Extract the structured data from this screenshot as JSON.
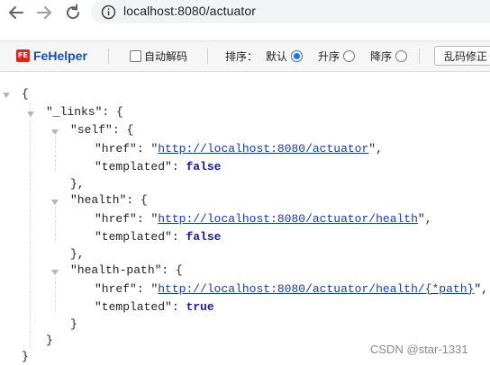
{
  "browser": {
    "url": "localhost:8080/actuator"
  },
  "fehelper": {
    "logo_mark": "FE",
    "logo_text": "FeHelper",
    "auto_decode_label": "自动解码",
    "sort_label": "排序：",
    "sort_options": [
      {
        "label": "默认",
        "selected": true
      },
      {
        "label": "升序",
        "selected": false
      },
      {
        "label": "降序",
        "selected": false
      }
    ],
    "fix_button_label": "乱码修正"
  },
  "json": {
    "open_root": "{",
    "links_key": "\"_links\"",
    "open_obj": "{",
    "colon": ":",
    "comma": ",",
    "close_obj_comma": "},",
    "close_obj": "}",
    "self_key": "\"self\"",
    "health_key": "\"health\"",
    "health_path_key": "\"health-path\"",
    "href_key": "\"href\"",
    "templated_key": "\"templated\"",
    "quote": "\"",
    "self_href": "http://localhost:8080/actuator",
    "health_href": "http://localhost:8080/actuator/health",
    "health_path_href": "http://localhost:8080/actuator/health/{*path}",
    "self_templated": "false",
    "health_templated": "false",
    "health_path_templated": "true",
    "close_root": "}"
  },
  "watermark": "CSDN @star-1331"
}
